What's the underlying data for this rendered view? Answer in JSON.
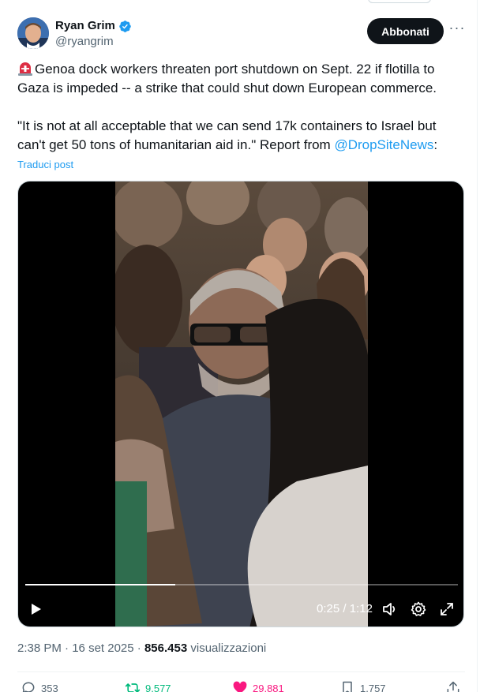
{
  "author": {
    "display_name": "Ryan Grim",
    "handle": "@ryangrim",
    "verified_color": "#1d9bf0"
  },
  "follow_button": {
    "label": "Abbonati"
  },
  "more_icon": "more-horizontal-icon",
  "tweet": {
    "line1": "Genoa dock workers threaten port shutdown on Sept. 22 if flotilla to Gaza is impeded -- a strike that could shut down European commerce.",
    "line2_text": "\"It is not at all acceptable that we can send 17k containers to Israel but can't get 50 tons of humanitarian aid in.\" Report from ",
    "mention": "@DropSiteNews",
    "line2_end": ":",
    "emoji": "rotating-light-emoji"
  },
  "translate_label": "Traduci post",
  "video": {
    "current_time": "0:25",
    "separator": "/",
    "duration": "1:12",
    "progress": 0.347,
    "icons": [
      "play-icon",
      "volume-icon",
      "settings-icon",
      "fullscreen-icon"
    ]
  },
  "meta": {
    "time": "2:38 PM",
    "dot1": "·",
    "date": "16 set 2025",
    "dot2": "·",
    "views": "856.453",
    "views_label": "visualizzazioni"
  },
  "actions": {
    "replies": "353",
    "reposts": "9.577",
    "likes": "29.881",
    "bookmarks": "1.757"
  },
  "colors": {
    "accent": "#1d9bf0",
    "text": "#0f1419",
    "secondary": "#536471",
    "repost": "#00ba7c",
    "like": "#f91880"
  }
}
